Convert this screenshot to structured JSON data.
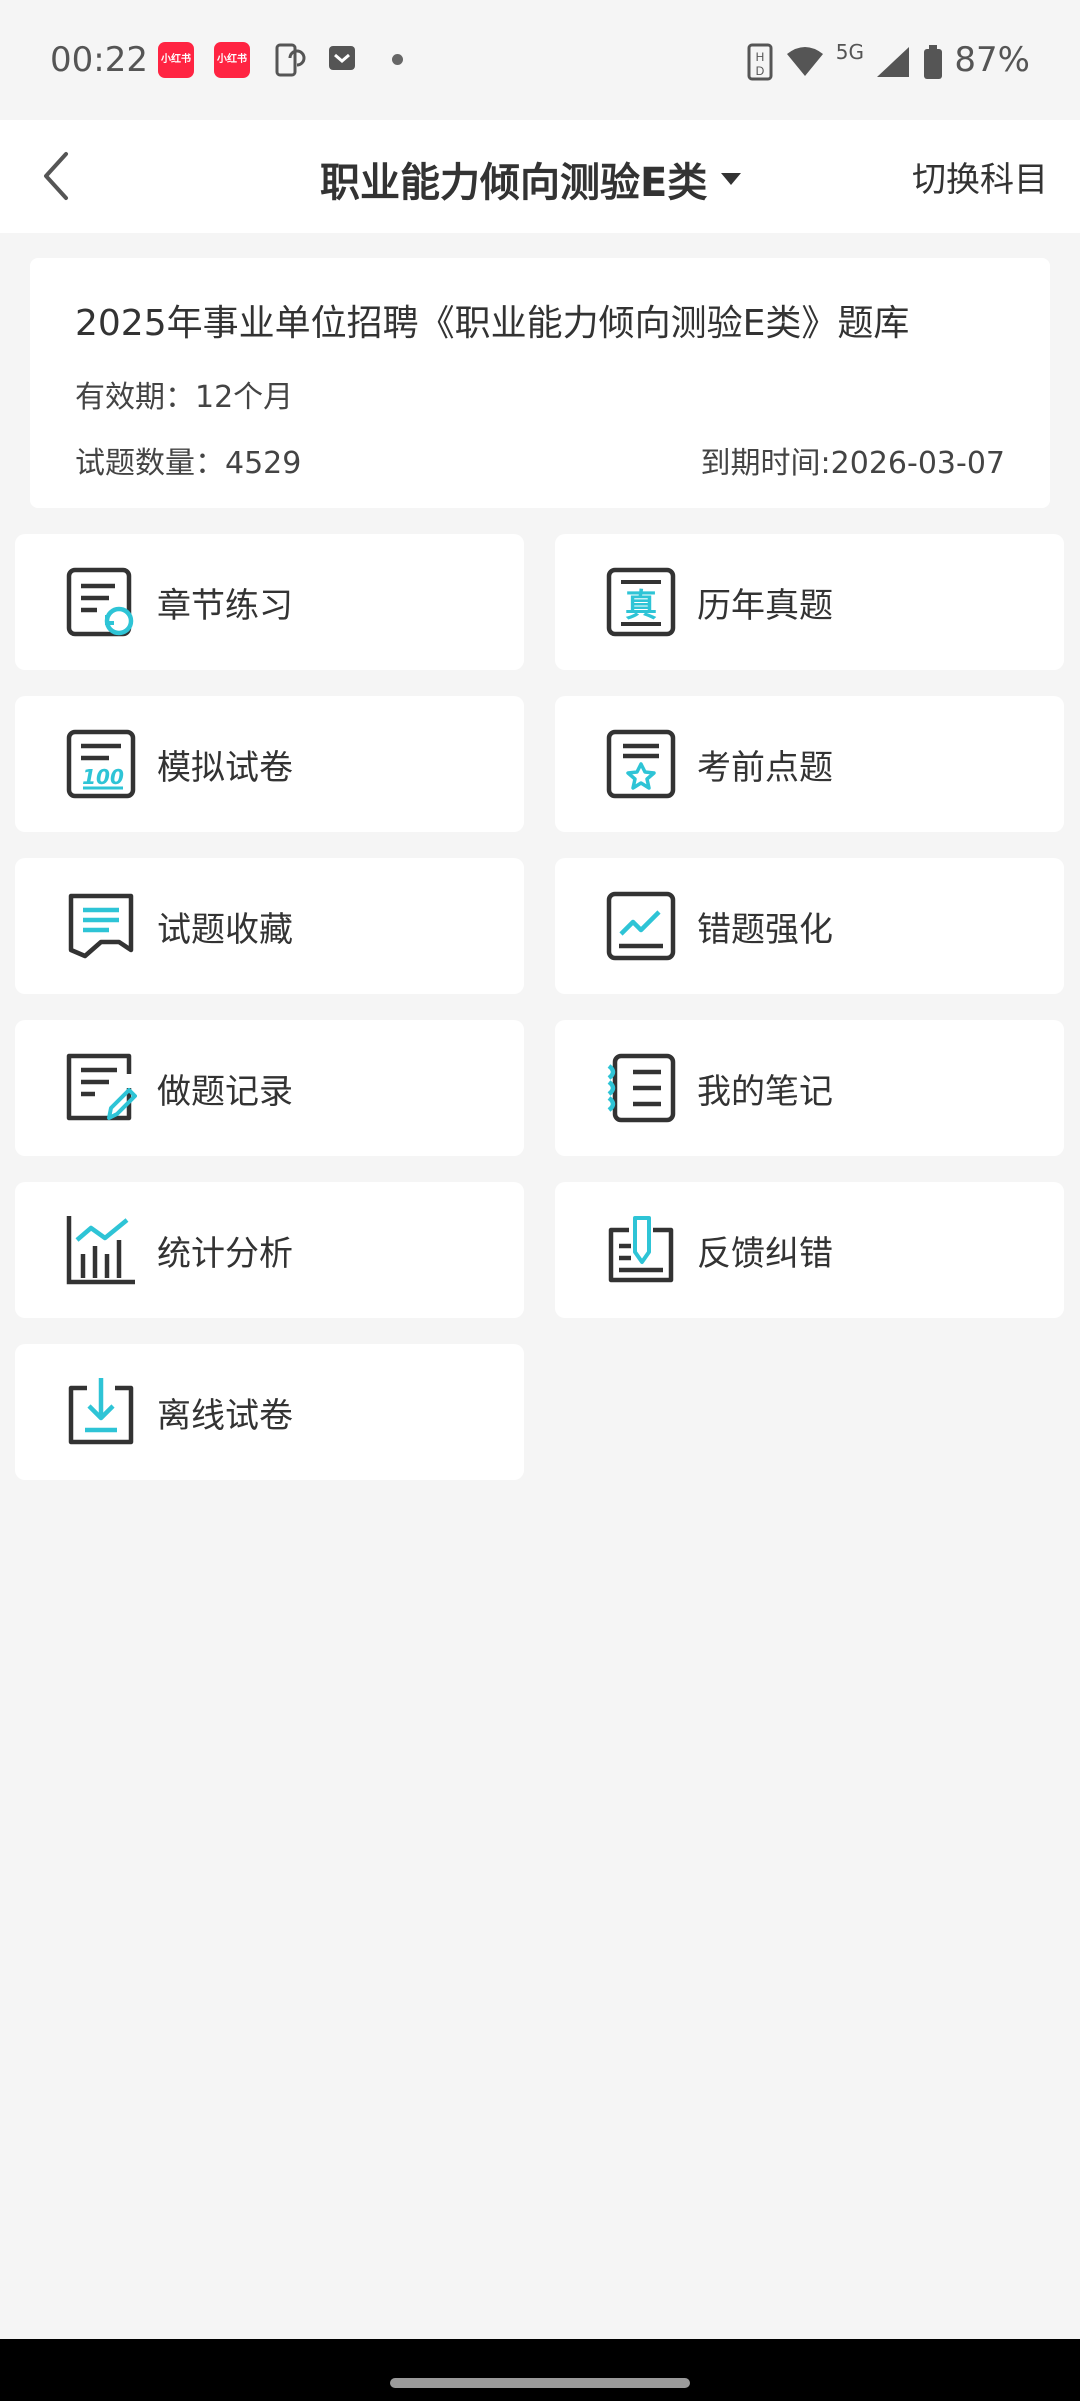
{
  "status_bar": {
    "time": "00:22",
    "notif_app": "小红书",
    "network": "5G",
    "battery": "87%"
  },
  "header": {
    "title": "职业能力倾向测验E类",
    "switch_label": "切换科目",
    "back_icon": "chevron-left-icon",
    "dropdown_icon": "triangle-down-icon"
  },
  "info": {
    "title": "2025年事业单位招聘《职业能力倾向测验E类》题库",
    "validity": "有效期：12个月",
    "count": "试题数量：4529",
    "expire": "到期时间:2026-03-07"
  },
  "menu": [
    {
      "label": "章节练习",
      "icon": "chapter-practice-icon"
    },
    {
      "label": "历年真题",
      "icon": "past-papers-icon"
    },
    {
      "label": "模拟试卷",
      "icon": "mock-exam-icon"
    },
    {
      "label": "考前点题",
      "icon": "key-points-icon"
    },
    {
      "label": "试题收藏",
      "icon": "favorites-icon"
    },
    {
      "label": "错题强化",
      "icon": "wrong-questions-icon"
    },
    {
      "label": "做题记录",
      "icon": "history-icon"
    },
    {
      "label": "我的笔记",
      "icon": "notes-icon"
    },
    {
      "label": "统计分析",
      "icon": "statistics-icon"
    },
    {
      "label": "反馈纠错",
      "icon": "feedback-icon"
    },
    {
      "label": "离线试卷",
      "icon": "offline-download-icon"
    }
  ],
  "colors": {
    "accent": "#2ec4d6",
    "icon_dark": "#333333",
    "background": "#f5f5f5",
    "card": "#ffffff"
  }
}
